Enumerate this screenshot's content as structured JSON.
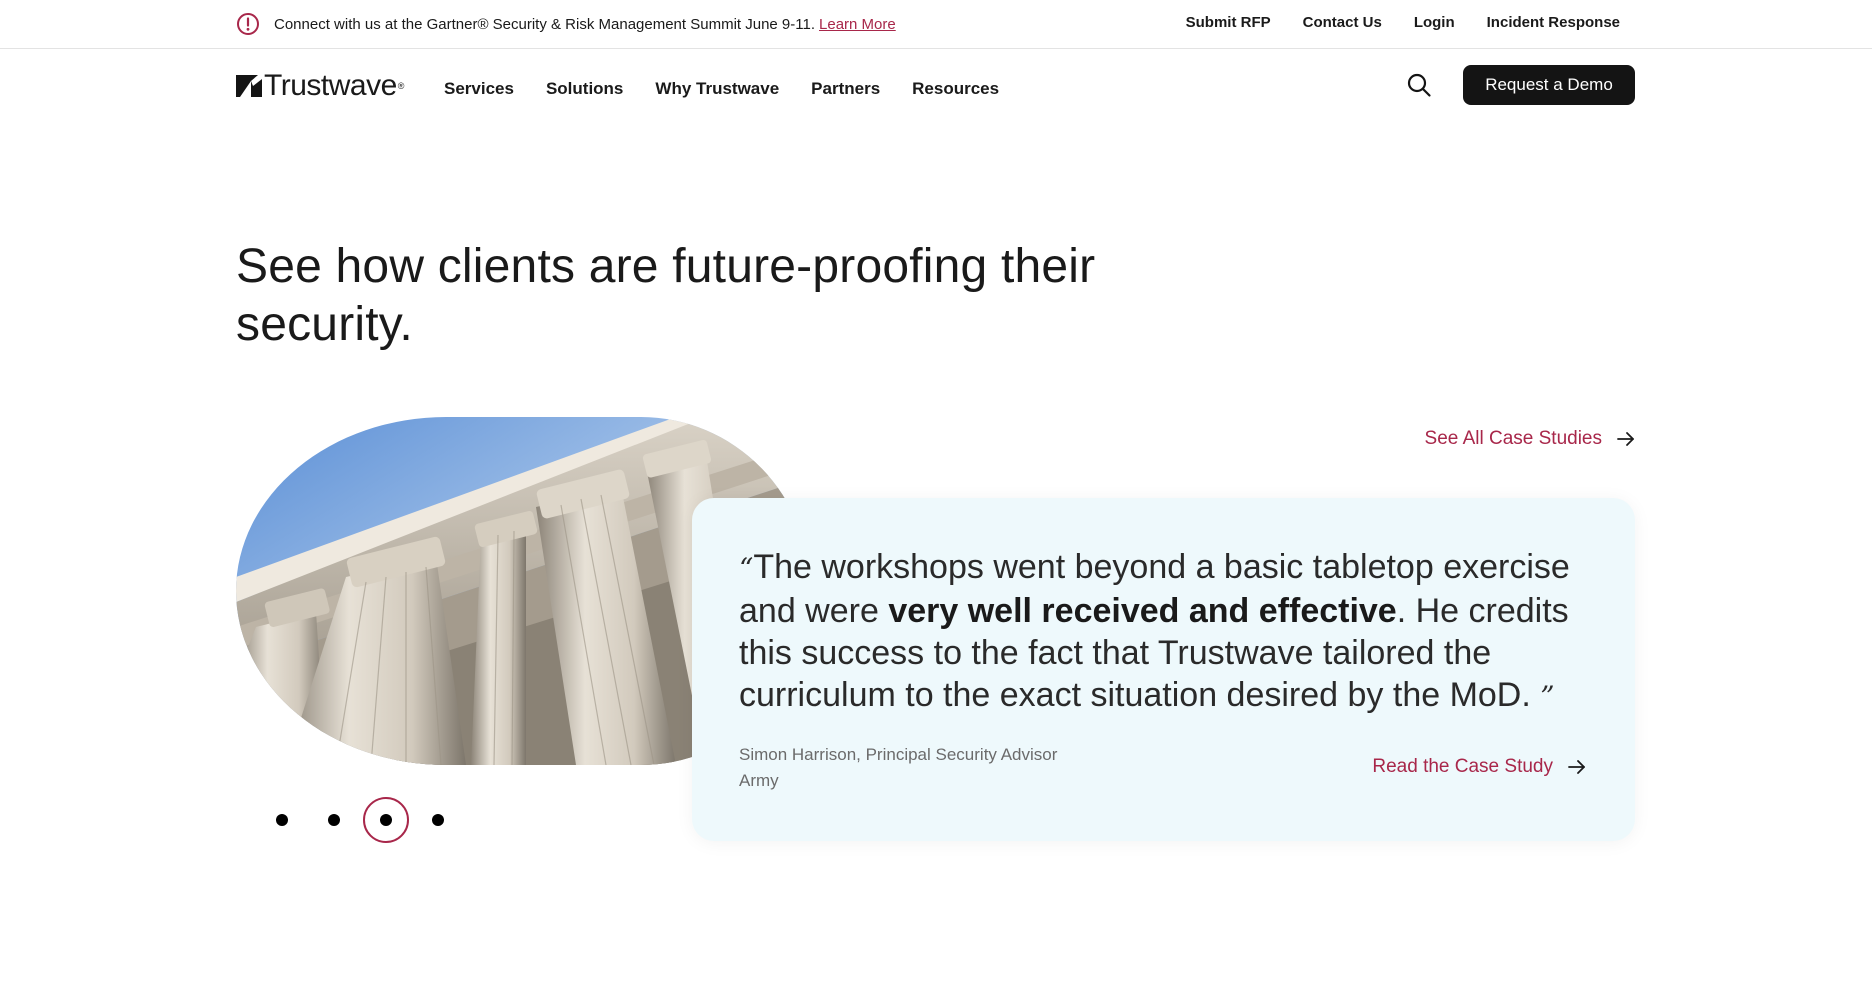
{
  "announcement": {
    "text": "Connect with us at the Gartner® Security & Risk Management Summit June 9-11.",
    "link": "Learn More"
  },
  "utility_nav": [
    "Submit RFP",
    "Contact Us",
    "Login",
    "Incident Response"
  ],
  "brand": {
    "name": "Trustwave",
    "reg": "®"
  },
  "main_nav": [
    "Services",
    "Solutions",
    "Why Trustwave",
    "Partners",
    "Resources"
  ],
  "cta": {
    "demo": "Request a Demo"
  },
  "hero": {
    "headline_line1": "See how clients are future-proofing their",
    "headline_line2": "security."
  },
  "case_studies": {
    "see_all": "See All Case Studies",
    "quote_open": "“",
    "quote_part1": "The workshops went beyond a basic tabletop exercise and were ",
    "quote_bold": "very well received and effective",
    "quote_part2": ". He credits this success to the fact that Trustwave tailored the curriculum to the exact situation desired by the MoD. ",
    "quote_close": "”",
    "author_name": "Simon Harrison, Principal Security Advisor",
    "author_org": "Army",
    "read_link": "Read the Case Study",
    "carousel": {
      "total": 4,
      "active": 3
    }
  },
  "colors": {
    "accent": "#a8274a",
    "dark": "#141414",
    "card_bg": "#eef9fc"
  },
  "icons": [
    "alert-circle-icon",
    "search-icon",
    "arrow-right-icon",
    "trustwave-logo-icon"
  ]
}
